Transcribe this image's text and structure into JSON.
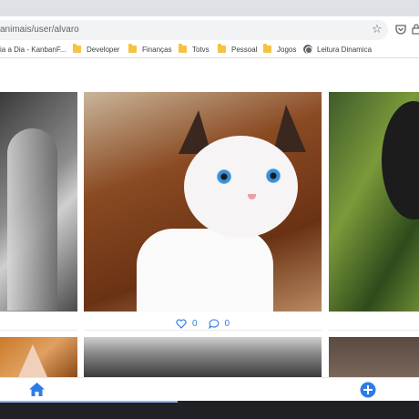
{
  "browser": {
    "url": "animais/user/alvaro",
    "bookmarks": [
      {
        "label": "ia a Dia - KanbanF...",
        "icon": "none"
      },
      {
        "label": "Developer",
        "icon": "folder-icon"
      },
      {
        "label": "Finanças",
        "icon": "folder-icon"
      },
      {
        "label": "Totvs",
        "icon": "folder-icon"
      },
      {
        "label": "Pessoal",
        "icon": "folder-icon"
      },
      {
        "label": "Jogos",
        "icon": "folder-icon"
      },
      {
        "label": "Leitura Dinamica",
        "icon": "globe-icon"
      }
    ]
  },
  "feed": {
    "photos": [
      {
        "name": "gray-cat-photo",
        "color": "#7a7a7a"
      },
      {
        "name": "white-kitten-photo",
        "color": "#f6f4f4"
      },
      {
        "name": "black-cat-photo",
        "color": "#1c1c1c"
      },
      {
        "name": "orange-cat-photo",
        "color": "#c97a2a"
      },
      {
        "name": "fur-photo",
        "color": "#8a8a8a"
      },
      {
        "name": "brown-photo",
        "color": "#5a4a40"
      }
    ],
    "likes": "0",
    "comments": "0",
    "accent_color": "#2e7ce6"
  },
  "nav": {
    "home_icon": "home-icon",
    "add_icon": "plus-circle-icon"
  }
}
